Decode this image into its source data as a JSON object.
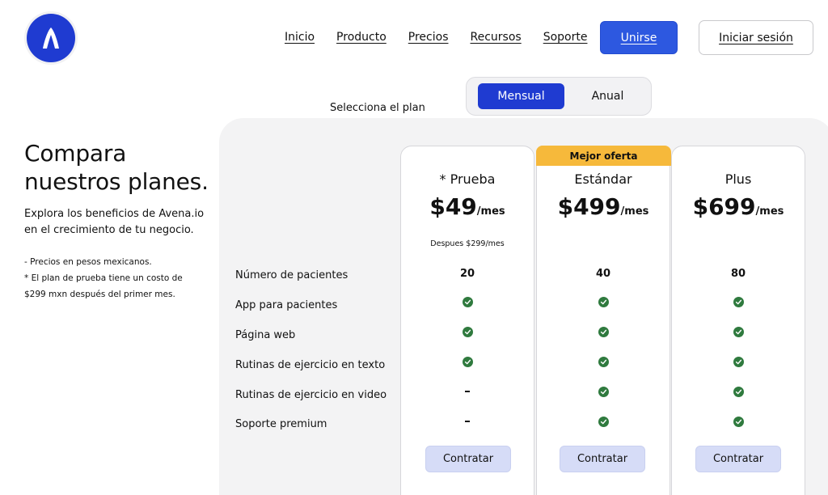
{
  "nav": {
    "items": [
      {
        "name": "nav-link-inicio",
        "label": "Inicio"
      },
      {
        "name": "nav-link-producto",
        "label": "Producto"
      },
      {
        "name": "nav-link-precios",
        "label": "Precios"
      },
      {
        "name": "nav-link-recursos",
        "label": "Recursos"
      },
      {
        "name": "nav-link-soporte",
        "label": "Soporte"
      }
    ],
    "join_label": "Unirse",
    "login_label": "Iniciar sesión"
  },
  "plan_selector": {
    "label": "Selecciona el plan",
    "options": [
      "Mensual",
      "Anual"
    ],
    "selected": "Mensual"
  },
  "intro": {
    "title_line1": "Compara",
    "title_line2": "nuestros planes.",
    "desc_line1": "Explora los beneficios de Avena.io",
    "desc_line2": "en el crecimiento de tu negocio.",
    "note1": "- Precios en pesos mexicanos.",
    "note2_line1": "* El plan de prueba tiene un costo de",
    "note2_line2": "$299 mxn después del primer mes."
  },
  "features": [
    "Número de pacientes",
    "App para pacientes",
    "Página web",
    "Rutinas de ejercicio en texto",
    "Rutinas de ejercicio en video",
    "Soporte premium"
  ],
  "plans": [
    {
      "name": "* Prueba",
      "price": "$49",
      "period": "/mes",
      "after": "Despues $299/mes",
      "patients": "20",
      "values": [
        "check",
        "check",
        "check",
        "dash",
        "dash"
      ],
      "cta": "Contratar"
    },
    {
      "name": "Estándar",
      "badge": "Mejor oferta",
      "price": "$499",
      "period": "/mes",
      "patients": "40",
      "values": [
        "check",
        "check",
        "check",
        "check",
        "check"
      ],
      "cta": "Contratar"
    },
    {
      "name": "Plus",
      "price": "$699",
      "period": "/mes",
      "patients": "80",
      "values": [
        "check",
        "check",
        "check",
        "check",
        "check"
      ],
      "cta": "Contratar"
    }
  ],
  "colors": {
    "brand": "#1f3bd1",
    "join_button": "#2d58e0",
    "badge": "#f6b93b",
    "check": "#2f7a3e",
    "cta": "#d6dcf7"
  },
  "icons": {
    "logo": "avena-logo-icon",
    "included": "check-circle-icon",
    "not_included": "dash-icon"
  }
}
